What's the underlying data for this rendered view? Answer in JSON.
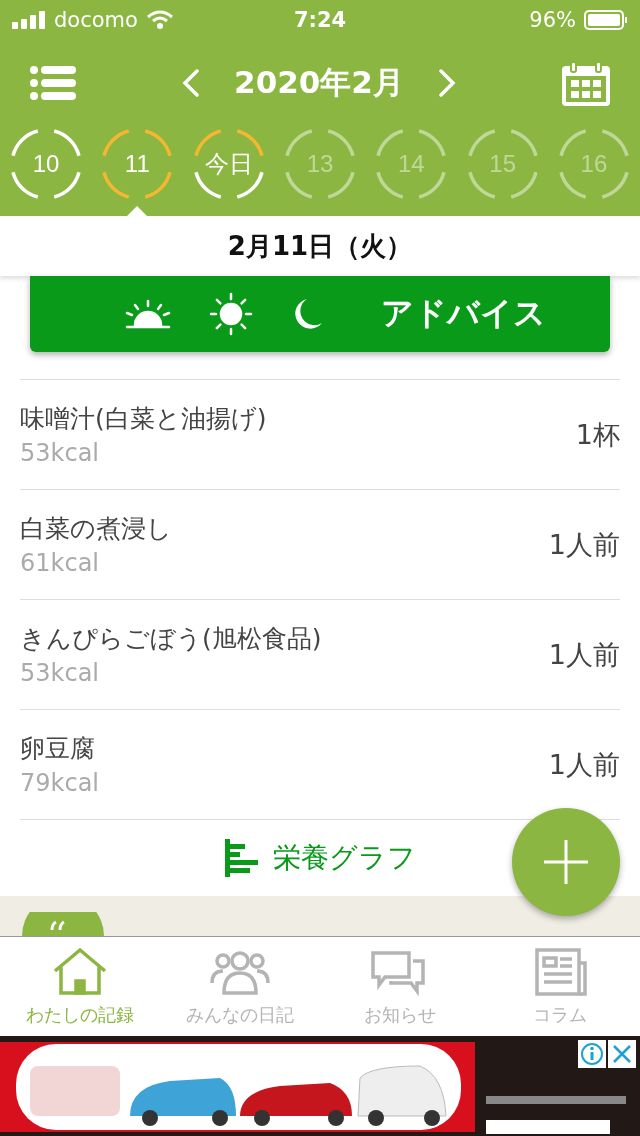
{
  "status_bar": {
    "carrier": "docomo",
    "time": "7:24",
    "battery": "96%"
  },
  "header": {
    "month": "2020年2月"
  },
  "days": [
    {
      "label": "10",
      "selected": false,
      "future": false,
      "kind": "good"
    },
    {
      "label": "11",
      "selected": true,
      "future": false,
      "kind": "warning"
    },
    {
      "label": "今日",
      "selected": false,
      "future": false,
      "kind": "partial"
    },
    {
      "label": "13",
      "selected": false,
      "future": true,
      "kind": "good"
    },
    {
      "label": "14",
      "selected": false,
      "future": true,
      "kind": "good"
    },
    {
      "label": "15",
      "selected": false,
      "future": true,
      "kind": "good"
    },
    {
      "label": "16",
      "selected": false,
      "future": true,
      "kind": "good"
    }
  ],
  "date": "2月11日（火）",
  "advice": {
    "label": "アドバイス"
  },
  "foods": [
    {
      "name": "味噌汁(白菜と油揚げ)",
      "kcal": "53kcal",
      "amount": "1杯"
    },
    {
      "name": "白菜の煮浸し",
      "kcal": "61kcal",
      "amount": "1人前"
    },
    {
      "name": "きんぴらごぼう(旭松食品)",
      "kcal": "53kcal",
      "amount": "1人前"
    },
    {
      "name": "卵豆腐",
      "kcal": "79kcal",
      "amount": "1人前"
    }
  ],
  "graph_link": "栄養グラフ",
  "nav": [
    {
      "label": "わたしの記録",
      "selected": true
    },
    {
      "label": "みんなの日記",
      "selected": false
    },
    {
      "label": "お知らせ",
      "selected": false
    },
    {
      "label": "コラム",
      "selected": false
    }
  ]
}
